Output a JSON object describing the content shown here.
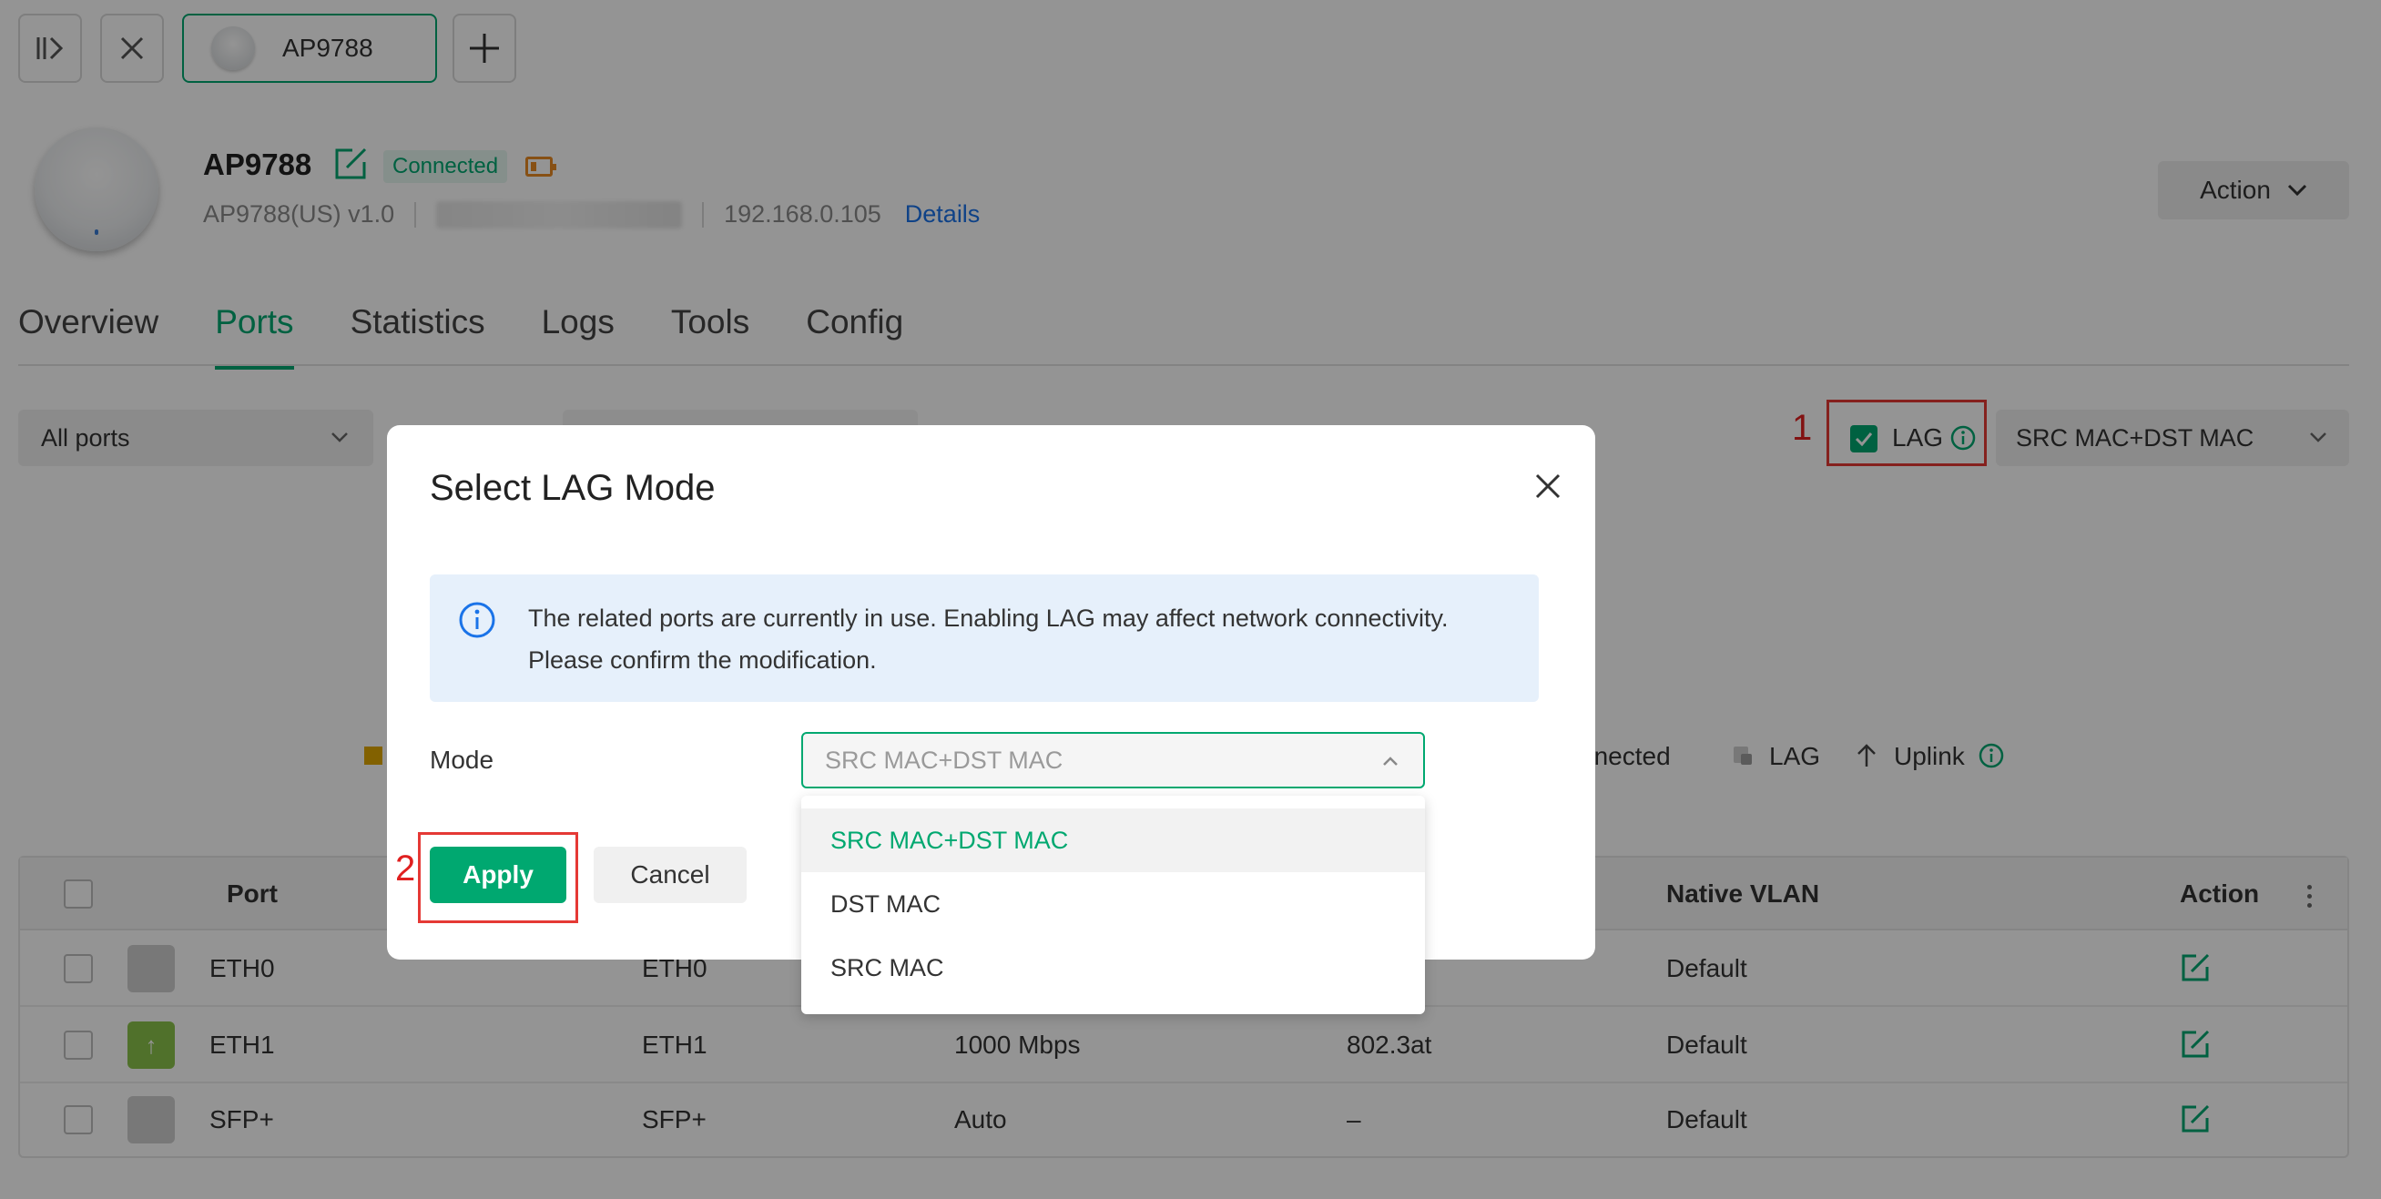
{
  "tabbar": {
    "device_tab_label": "AP9788"
  },
  "device": {
    "name": "AP9788",
    "status": "Connected",
    "model": "AP9788(US) v1.0",
    "ip": "192.168.0.105",
    "details_link": "Details",
    "action_label": "Action"
  },
  "nav": {
    "tabs": [
      {
        "label": "Overview"
      },
      {
        "label": "Ports"
      },
      {
        "label": "Statistics"
      },
      {
        "label": "Logs"
      },
      {
        "label": "Tools"
      },
      {
        "label": "Config"
      }
    ],
    "active": "Ports"
  },
  "filters": {
    "port_filter": "All ports",
    "lag_label": "LAG",
    "lag_mode_value": "SRC MAC+DST MAC"
  },
  "legend": {
    "connected": "nnected",
    "lag": "LAG",
    "uplink": "Uplink"
  },
  "table": {
    "headers": {
      "port": "Port",
      "native_vlan": "Native VLAN",
      "action": "Action"
    },
    "rows": [
      {
        "port": "ETH0",
        "name": "ETH0",
        "speed": "",
        "poe": "",
        "vlan": "Default"
      },
      {
        "port": "ETH1",
        "name": "ETH1",
        "speed": "1000 Mbps",
        "poe": "802.3at",
        "vlan": "Default"
      },
      {
        "port": "SFP+",
        "name": "SFP+",
        "speed": "Auto",
        "poe": "–",
        "vlan": "Default"
      }
    ]
  },
  "modal": {
    "title": "Select LAG Mode",
    "info_line1": "The related ports are currently in use. Enabling LAG may affect network connectivity.",
    "info_line2": "Please confirm the modification.",
    "mode_label": "Mode",
    "mode_value": "SRC MAC+DST MAC",
    "apply_label": "Apply",
    "cancel_label": "Cancel",
    "options": [
      "SRC MAC+DST MAC",
      "DST MAC",
      "SRC MAC"
    ]
  },
  "annotations": {
    "step1": "1",
    "step2": "2"
  },
  "colors": {
    "accent": "#00a870",
    "highlight": "#e53935",
    "link": "#1a73e8"
  }
}
